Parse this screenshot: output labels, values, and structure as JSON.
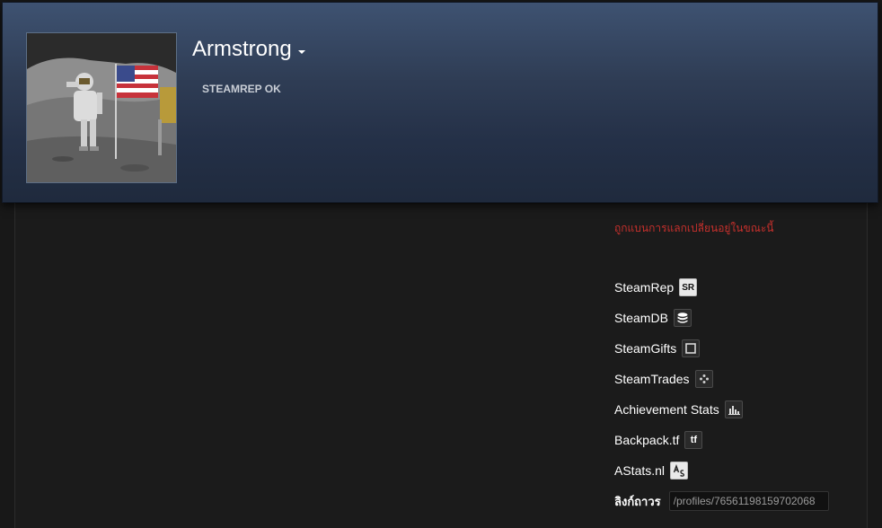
{
  "profile": {
    "name": "Armstrong",
    "steamrep_status": "STEAMREP OK",
    "ban_notice": "ถูกแบนการแลกเปลี่ยนอยู่ในขณะนี้"
  },
  "links": [
    {
      "label": "SteamRep",
      "icon": "steamrep-icon",
      "icon_text": "SR"
    },
    {
      "label": "SteamDB",
      "icon": "steamdb-icon"
    },
    {
      "label": "SteamGifts",
      "icon": "steamgifts-icon"
    },
    {
      "label": "SteamTrades",
      "icon": "steamtrades-icon"
    },
    {
      "label": "Achievement Stats",
      "icon": "achievement-stats-icon"
    },
    {
      "label": "Backpack.tf",
      "icon": "backpack-tf-icon",
      "icon_text": "tf"
    },
    {
      "label": "AStats.nl",
      "icon": "astats-icon"
    }
  ],
  "permalink": {
    "label": "ลิงก์ถาวร",
    "value": "/profiles/76561198159702068"
  },
  "colors": {
    "header_top": "#3e5271",
    "header_bottom": "#1f2a3d",
    "ban_text": "#c6302c",
    "page_bg": "#1b1b1b"
  }
}
